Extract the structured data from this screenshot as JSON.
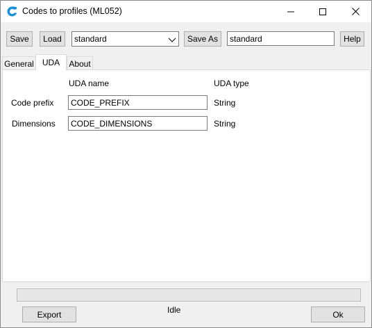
{
  "window": {
    "title": "Codes to profiles (ML052)",
    "icons": [
      "app-logo-icon",
      "minimize-icon",
      "maximize-icon",
      "close-icon"
    ]
  },
  "toolbar": {
    "save_label": "Save",
    "load_label": "Load",
    "settings_selected": "standard",
    "save_as_label": "Save As",
    "save_as_name": "standard",
    "help_label": "Help"
  },
  "tabs": [
    {
      "label": "General",
      "active": false
    },
    {
      "label": "UDA",
      "active": true
    },
    {
      "label": "About",
      "active": false
    }
  ],
  "uda": {
    "col_name_header": "UDA name",
    "col_type_header": "UDA type",
    "rows": [
      {
        "label": "Code prefix",
        "value": "CODE_PREFIX",
        "type": "String"
      },
      {
        "label": "Dimensions",
        "value": "CODE_DIMENSIONS",
        "type": "String"
      }
    ]
  },
  "footer": {
    "export_label": "Export",
    "status": "Idle",
    "ok_label": "Ok",
    "progress": 0
  },
  "colors": {
    "accent": "#1a8fd8",
    "button_face": "#e1e1e1",
    "window_bg": "#f0f0f0"
  }
}
